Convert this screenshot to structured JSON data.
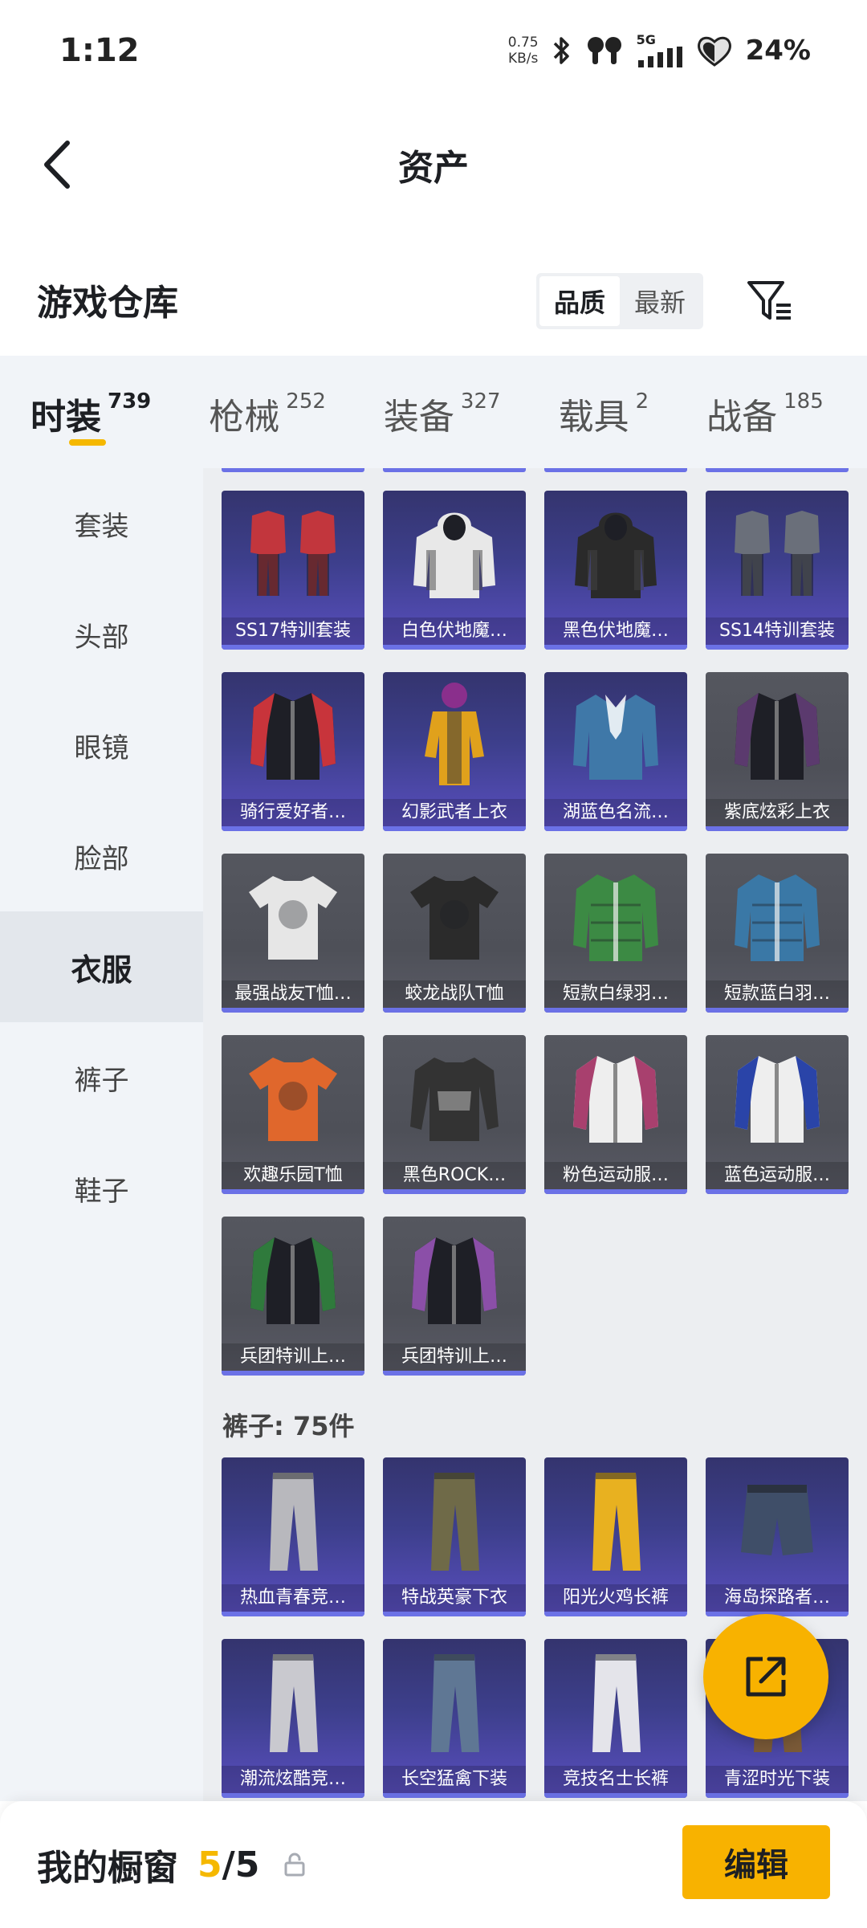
{
  "status_bar": {
    "time": "1:12",
    "net_speed_value": "0.75",
    "net_speed_unit": "KB/s",
    "network": "5G",
    "battery": "24%",
    "icons": [
      "bluetooth-icon",
      "earbuds-icon",
      "signal-icon",
      "battery-heart-icon"
    ]
  },
  "header": {
    "title": "资产",
    "back_icon": "chevron-left-icon"
  },
  "warehouse": {
    "title": "游戏仓库",
    "sort_options": [
      "品质",
      "最新"
    ],
    "sort_selected": "品质",
    "filter_icon": "filter-icon"
  },
  "category_tabs": [
    {
      "label": "时装",
      "count": "739",
      "active": true
    },
    {
      "label": "枪械",
      "count": "252",
      "active": false
    },
    {
      "label": "装备",
      "count": "327",
      "active": false
    },
    {
      "label": "载具",
      "count": "2",
      "active": false
    },
    {
      "label": "战备",
      "count": "185",
      "active": false
    }
  ],
  "sidebar": {
    "items": [
      {
        "label": "套装",
        "active": false
      },
      {
        "label": "头部",
        "active": false
      },
      {
        "label": "眼镜",
        "active": false
      },
      {
        "label": "脸部",
        "active": false
      },
      {
        "label": "衣服",
        "active": true
      },
      {
        "label": "裤子",
        "active": false
      },
      {
        "label": "鞋子",
        "active": false
      }
    ]
  },
  "clothes_items": [
    {
      "name": "SS17特训套装",
      "tier": "purple",
      "art": "suit-pair-icon",
      "accent": "#c2363d"
    },
    {
      "name": "白色伏地魔…",
      "tier": "purple",
      "art": "hoodie-icon",
      "accent": "#e8e8e8"
    },
    {
      "name": "黑色伏地魔…",
      "tier": "purple",
      "art": "hoodie-icon",
      "accent": "#2a2a2a"
    },
    {
      "name": "SS14特训套装",
      "tier": "purple",
      "art": "suit-pair-icon",
      "accent": "#6a6f7a"
    },
    {
      "name": "骑行爱好者…",
      "tier": "purple",
      "art": "jacket-icon",
      "accent": "#c8343b"
    },
    {
      "name": "幻影武者上衣",
      "tier": "purple",
      "art": "figure-icon",
      "accent": "#e0a11c"
    },
    {
      "name": "湖蓝色名流…",
      "tier": "purple",
      "art": "blazer-icon",
      "accent": "#3f78a8"
    },
    {
      "name": "紫底炫彩上衣",
      "tier": "gray",
      "art": "jacket-icon",
      "accent": "#5b3a6e"
    },
    {
      "name": "最强战友T恤…",
      "tier": "gray",
      "art": "tshirt-icon",
      "accent": "#e6e6e6"
    },
    {
      "name": "蛟龙战队T恤",
      "tier": "gray",
      "art": "tshirt-icon",
      "accent": "#2b2b2b"
    },
    {
      "name": "短款白绿羽…",
      "tier": "gray",
      "art": "puffer-icon",
      "accent": "#3c8a44"
    },
    {
      "name": "短款蓝白羽…",
      "tier": "gray",
      "art": "puffer-icon",
      "accent": "#3a78a6"
    },
    {
      "name": "欢趣乐园T恤",
      "tier": "gray",
      "art": "tshirt-icon",
      "accent": "#e0672c"
    },
    {
      "name": "黑色ROCK…",
      "tier": "gray",
      "art": "longsleeve-icon",
      "accent": "#333333"
    },
    {
      "name": "粉色运动服…",
      "tier": "gray",
      "art": "track-jacket-icon",
      "accent": "#a8406e"
    },
    {
      "name": "蓝色运动服…",
      "tier": "gray",
      "art": "track-jacket-icon",
      "accent": "#2a44a8"
    },
    {
      "name": "兵团特训上…",
      "tier": "gray",
      "art": "jacket-icon",
      "accent": "#2f7a3c"
    },
    {
      "name": "兵团特训上…",
      "tier": "gray",
      "art": "jacket-icon",
      "accent": "#8b4fa8"
    }
  ],
  "pants_section": {
    "heading": "裤子: 75件",
    "items": [
      {
        "name": "热血青春竞…",
        "tier": "purple",
        "art": "pants-icon",
        "accent": "#b8b8bd"
      },
      {
        "name": "特战英豪下衣",
        "tier": "purple",
        "art": "pants-icon",
        "accent": "#6f6a48"
      },
      {
        "name": "阳光火鸡长裤",
        "tier": "purple",
        "art": "pants-icon",
        "accent": "#e8b120"
      },
      {
        "name": "海岛探路者…",
        "tier": "purple",
        "art": "shorts-icon",
        "accent": "#3f4e68"
      },
      {
        "name": "潮流炫酷竞…",
        "tier": "purple",
        "art": "pants-icon",
        "accent": "#c9c9cf"
      },
      {
        "name": "长空猛禽下装",
        "tier": "purple",
        "art": "pants-icon",
        "accent": "#5f7794"
      },
      {
        "name": "竞技名士长裤",
        "tier": "purple",
        "art": "pants-icon",
        "accent": "#e4e4ea"
      },
      {
        "name": "青涩时光下装",
        "tier": "purple",
        "art": "pants-icon",
        "accent": "#7a5a38"
      }
    ]
  },
  "fab": {
    "icon": "share-external-icon"
  },
  "showcase": {
    "label": "我的橱窗",
    "current": "5",
    "separator": "/",
    "total": "5",
    "lock_icon": "lock-icon",
    "edit_label": "编辑"
  },
  "colors": {
    "accent_yellow": "#f5b800",
    "tier_purple": "#5a4fc0",
    "tier_bar": "#6b71e6",
    "tier_gray": "#55575f"
  }
}
